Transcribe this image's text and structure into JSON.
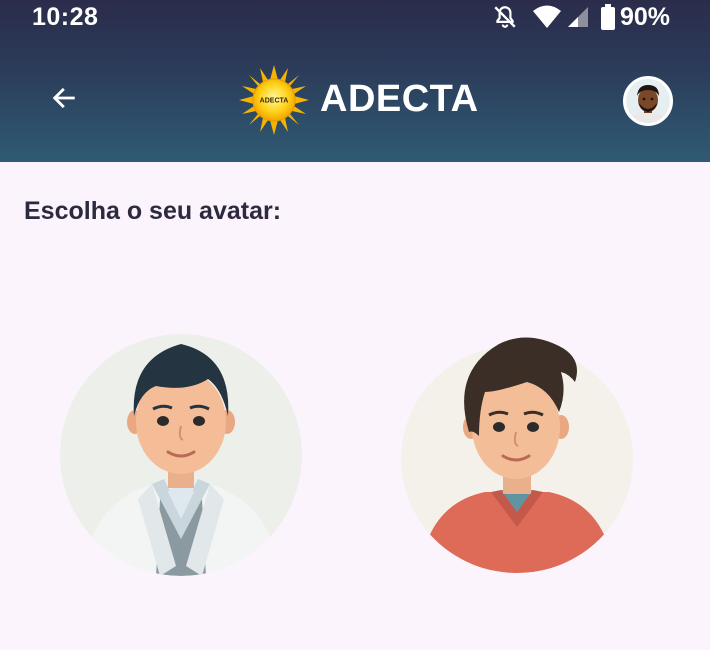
{
  "status_bar": {
    "time": "10:28",
    "battery": "90%",
    "icons": [
      "notifications-off-icon",
      "wifi-icon",
      "cellular-signal-icon",
      "battery-icon"
    ]
  },
  "app_bar": {
    "logo_text": "ADECTA",
    "title": "ADECTA",
    "back_icon": "arrow-left-icon",
    "colors": {
      "gradient_top": "#2b2c4b",
      "gradient_bottom": "#2f5a73"
    }
  },
  "main": {
    "title": "Escolha o seu avatar:",
    "avatars": [
      {
        "name": "doctor-avatar",
        "description_icon": "doctor-illustration"
      },
      {
        "name": "casual-avatar",
        "description_icon": "young-man-illustration"
      }
    ]
  },
  "colors": {
    "background": "#fbf4fd",
    "title_text": "#2d2a3f"
  }
}
